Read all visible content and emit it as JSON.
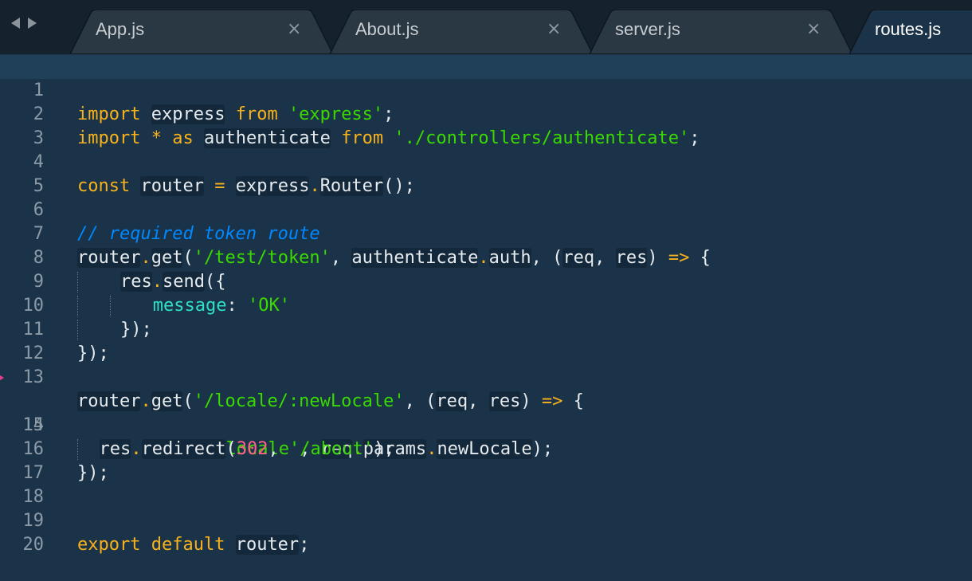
{
  "tabs": [
    {
      "label": "App.js",
      "close": "×"
    },
    {
      "label": "About.js",
      "close": "×"
    },
    {
      "label": "server.js",
      "close": "×"
    },
    {
      "label": "routes.js"
    }
  ],
  "line_numbers": [
    "1",
    "2",
    "3",
    "4",
    "5",
    "6",
    "7",
    "8",
    "9",
    "10",
    "11",
    "12",
    "13",
    "14",
    "15",
    "16",
    "17",
    "18",
    "19",
    "20"
  ],
  "code": {
    "l1": [
      "import",
      "express",
      "from",
      "'express'",
      ";"
    ],
    "l2": [
      "import",
      "*",
      "as",
      "authenticate",
      "from",
      "'./controllers/authenticate'",
      ";"
    ],
    "l4": [
      "const",
      "router",
      "=",
      "express",
      ".",
      "Router",
      "();"
    ],
    "l6": "// required token route",
    "l7": [
      "router",
      ".",
      "get",
      "(",
      "'/test/token'",
      ", ",
      "authenticate",
      ".",
      "auth",
      ", (",
      "req",
      ", ",
      "res",
      ") ",
      "=>",
      " {"
    ],
    "l8": [
      "res",
      ".",
      "send",
      "({"
    ],
    "l9": [
      "message",
      ": ",
      "'OK'"
    ],
    "l10": "});",
    "l11": "});",
    "l13": [
      "router",
      ".",
      "get",
      "(",
      "'/locale/:newLocale'",
      ", (",
      "req",
      ", ",
      "res",
      ") ",
      "=>",
      " {"
    ],
    "l14": [
      "res",
      ".",
      "cookie",
      "(",
      "'locale'",
      ", ",
      "req",
      ".",
      "params",
      ".",
      "newLocale",
      ");"
    ],
    "l15": [
      "res",
      ".",
      "redirect",
      "(",
      "302",
      ", ",
      "'/about'",
      ");"
    ],
    "l16": "});",
    "l19": [
      "export",
      "default",
      "router",
      ";"
    ]
  },
  "colors": {
    "background": "#1b3348",
    "keyword": "#f7b21c",
    "string": "#3ad900",
    "comment": "#0088ff",
    "number": "#ff5e8a",
    "property": "#2fe0c5"
  }
}
